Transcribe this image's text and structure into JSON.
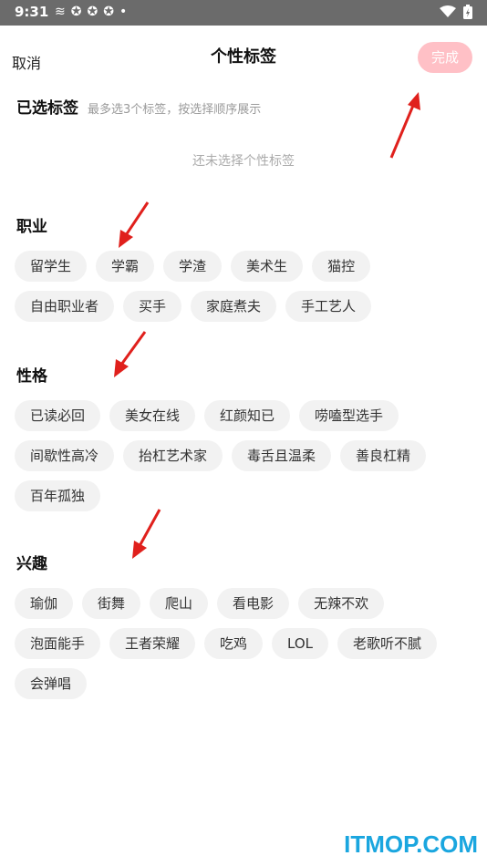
{
  "status": {
    "time": "9:31",
    "icons": [
      "app-icon",
      "sync-icon",
      "sync-icon",
      "sync-icon",
      "dot-icon"
    ]
  },
  "header": {
    "cancel": "取消",
    "title": "个性标签",
    "done": "完成"
  },
  "selected": {
    "heading": "已选标签",
    "hint": "最多选3个标签，按选择顺序展示",
    "empty": "还未选择个性标签"
  },
  "sections": {
    "job": {
      "heading": "职业",
      "tags": [
        "留学生",
        "学霸",
        "学渣",
        "美术生",
        "猫控",
        "自由职业者",
        "买手",
        "家庭煮夫",
        "手工艺人"
      ]
    },
    "personality": {
      "heading": "性格",
      "tags": [
        "已读必回",
        "美女在线",
        "红颜知已",
        "唠嗑型选手",
        "间歇性高冷",
        "抬杠艺术家",
        "毒舌且温柔",
        "善良杠精",
        "百年孤独"
      ]
    },
    "interest": {
      "heading": "兴趣",
      "tags": [
        "瑜伽",
        "街舞",
        "爬山",
        "看电影",
        "无辣不欢",
        "泡面能手",
        "王者荣耀",
        "吃鸡",
        "LOL",
        "老歌听不腻",
        "会弹唱"
      ]
    }
  },
  "watermark": "ITMOP.COM",
  "colors": {
    "accent_disabled": "#ffc0c6",
    "annotation_arrow": "#e0201c",
    "chip_bg": "#f2f2f2"
  }
}
